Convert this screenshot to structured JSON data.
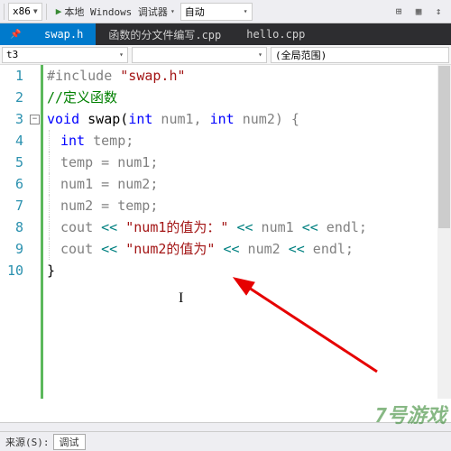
{
  "toolbar": {
    "arch": "x86",
    "debugger": "本地 Windows 调试器",
    "mode": "自动"
  },
  "tabs": {
    "t1": "swap.h",
    "t2": "函数的分文件编写.cpp",
    "t3": "hello.cpp"
  },
  "nav": {
    "left": "t3",
    "right": "(全局范围)"
  },
  "gutter": [
    "1",
    "2",
    "3",
    "4",
    "5",
    "6",
    "7",
    "8",
    "9",
    "10"
  ],
  "code": {
    "l1_include": "#include ",
    "l1_file": "\"swap.h\"",
    "l2": "//定义函数",
    "l3_void": "void",
    "l3_name": " swap(",
    "l3_int1": "int",
    "l3_num1": " num1, ",
    "l3_int2": "int",
    "l3_num2": " num2) {",
    "l4_int": "int",
    "l4_rest": " temp;",
    "l5": "temp = num1;",
    "l6": "num1 = num2;",
    "l7": "num2 = temp;",
    "l8_cout": "cout ",
    "l8_op1": "<<",
    "l8_s": " \"num1的值为：\" ",
    "l8_op2": "<<",
    "l8_n": " num1 ",
    "l8_op3": "<<",
    "l8_e": " endl;",
    "l9_cout": "cout ",
    "l9_op1": "<<",
    "l9_s": " \"num2的值为\" ",
    "l9_op2": "<<",
    "l9_n": " num2 ",
    "l9_op3": "<<",
    "l9_e": " endl;",
    "l10": "}"
  },
  "status": {
    "label": "来源(S):",
    "value": "调试"
  },
  "watermark": "7号游戏"
}
